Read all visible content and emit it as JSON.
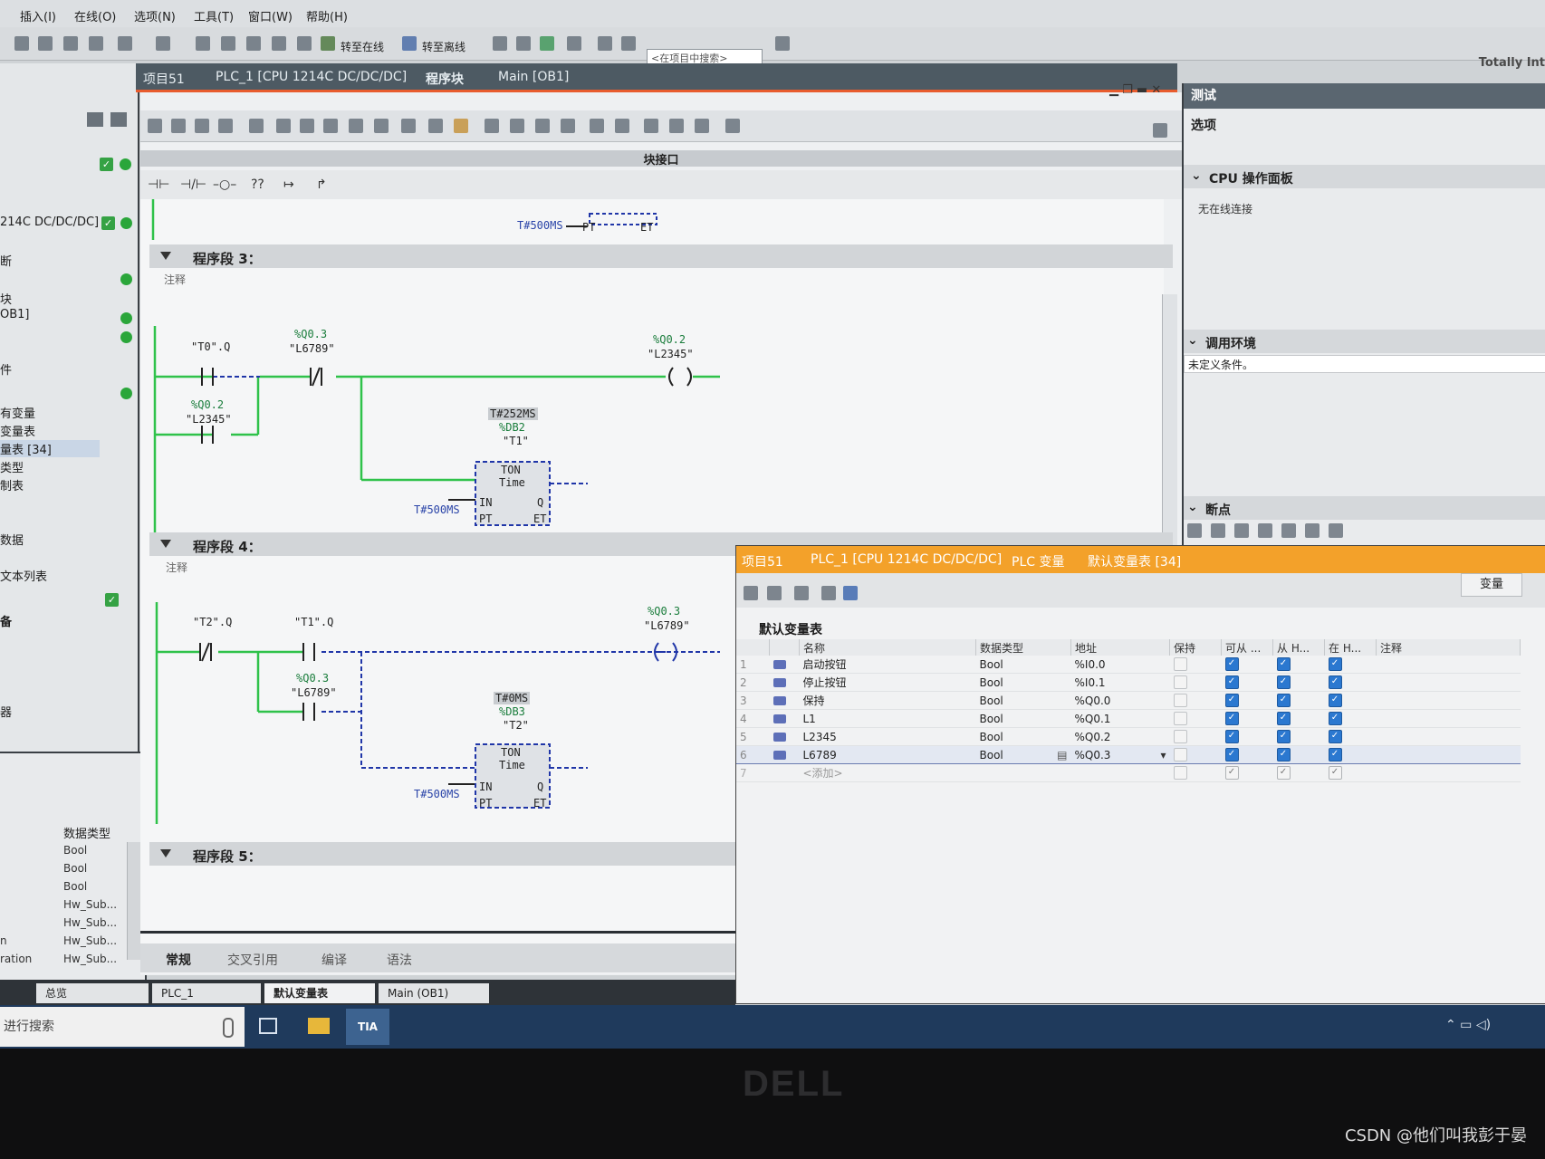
{
  "menu": [
    "插入(I)",
    "在线(O)",
    "选项(N)",
    "工具(T)",
    "窗口(W)",
    "帮助(H)"
  ],
  "toolbar": {
    "go_online": "转至在线",
    "go_offline": "转至离线",
    "search_placeholder": "<在项目中搜索>",
    "brand": "Totally Int"
  },
  "breadcrumb": [
    "项目51",
    "PLC_1 [CPU 1214C DC/DC/DC]",
    "程序块",
    "Main [OB1]"
  ],
  "editor": {
    "block_interface": "块接口",
    "instructions": [
      "⊣⊢",
      "⊣/⊢",
      "–○–",
      "??",
      "↦",
      "↱"
    ]
  },
  "left_tree": {
    "rows": [
      "214C DC/DC/DC]",
      "断",
      "块",
      "OB1]",
      "件",
      "有变量",
      "变量表",
      "量表 [34]",
      "类型",
      "制表",
      "数据",
      "文本列表",
      "备",
      "器"
    ]
  },
  "left_detail": {
    "header": "数据类型",
    "types": [
      "Bool",
      "Bool",
      "Bool",
      "Hw_Sub...",
      "Hw_Sub...",
      "Hw_Sub...",
      "Hw_Sub..."
    ],
    "names": [
      "",
      "",
      "",
      "",
      "",
      "n",
      "ration"
    ]
  },
  "network_top": {
    "pt": "T#500MS",
    "pt_pin": "PT",
    "et_pin": "ET"
  },
  "network3": {
    "title": "程序段 3：",
    "comment": "注释",
    "contact1": "\"T0\".Q",
    "contact2_addr": "%Q0.3",
    "contact2_name": "\"L6789\"",
    "coil_addr": "%Q0.2",
    "coil_name": "\"L2345\"",
    "branch_addr": "%Q0.2",
    "branch_name": "\"L2345\"",
    "timer_time": "T#252MS",
    "timer_db": "%DB2",
    "timer_name": "\"T1\"",
    "timer_type": "TON",
    "timer_sub": "Time",
    "pin_in": "IN",
    "pin_pt": "PT",
    "pin_q": "Q",
    "pin_et": "ET",
    "pt_value": "T#500MS"
  },
  "network4": {
    "title": "程序段 4：",
    "comment": "注释",
    "contact1": "\"T2\".Q",
    "contact2": "\"T1\".Q",
    "coil_addr": "%Q0.3",
    "coil_name": "\"L6789\"",
    "branch_addr": "%Q0.3",
    "branch_name": "\"L6789\"",
    "timer_time": "T#0MS",
    "timer_db": "%DB3",
    "timer_name": "\"T2\"",
    "timer_type": "TON",
    "timer_sub": "Time",
    "pin_in": "IN",
    "pin_pt": "PT",
    "pin_q": "Q",
    "pin_et": "ET",
    "pt_value": "T#500MS"
  },
  "network5": {
    "title": "程序段 5："
  },
  "editor_tabs": [
    "常规",
    "交叉引用",
    "编译",
    "语法"
  ],
  "right_panel": {
    "title": "测试",
    "options": "选项",
    "cpu_panel": "CPU 操作面板",
    "no_connection": "无在线连接",
    "call_env": "调用环境",
    "undefined_condition": "未定义条件。",
    "breakpoints": "断点"
  },
  "var_table": {
    "breadcrumb": [
      "项目51",
      "PLC_1 [CPU 1214C DC/DC/DC]",
      "PLC 变量",
      "默认变量表 [34]"
    ],
    "tab_label": "变量",
    "subtitle": "默认变量表",
    "columns": [
      "名称",
      "数据类型",
      "地址",
      "保持",
      "可从 ...",
      "从 H...",
      "在 H...",
      "注释"
    ],
    "rows": [
      {
        "idx": "1",
        "name": "启动按钮",
        "type": "Bool",
        "addr": "%I0.0"
      },
      {
        "idx": "2",
        "name": "停止按钮",
        "type": "Bool",
        "addr": "%I0.1"
      },
      {
        "idx": "3",
        "name": "保持",
        "type": "Bool",
        "addr": "%Q0.0"
      },
      {
        "idx": "4",
        "name": "L1",
        "type": "Bool",
        "addr": "%Q0.1"
      },
      {
        "idx": "5",
        "name": "L2345",
        "type": "Bool",
        "addr": "%Q0.2"
      },
      {
        "idx": "6",
        "name": "L6789",
        "type": "Bool",
        "addr": "%Q0.3"
      }
    ],
    "add_row": {
      "idx": "7",
      "label": "<添加>"
    }
  },
  "task_tabs": [
    "总览",
    "PLC_1",
    "默认变量表",
    "Main (OB1)"
  ],
  "taskbar": {
    "search": "进行搜索",
    "tia": "TIA V14"
  },
  "bezel": {
    "logo": "DELL",
    "watermark": "CSDN @他们叫我彭于晏"
  },
  "colors": {
    "accent_orange": "#f3a12a",
    "power_flow_green": "#2fc24a",
    "breadcrumb_bg": "#4d5a63",
    "check_blue": "#2b78d0"
  }
}
